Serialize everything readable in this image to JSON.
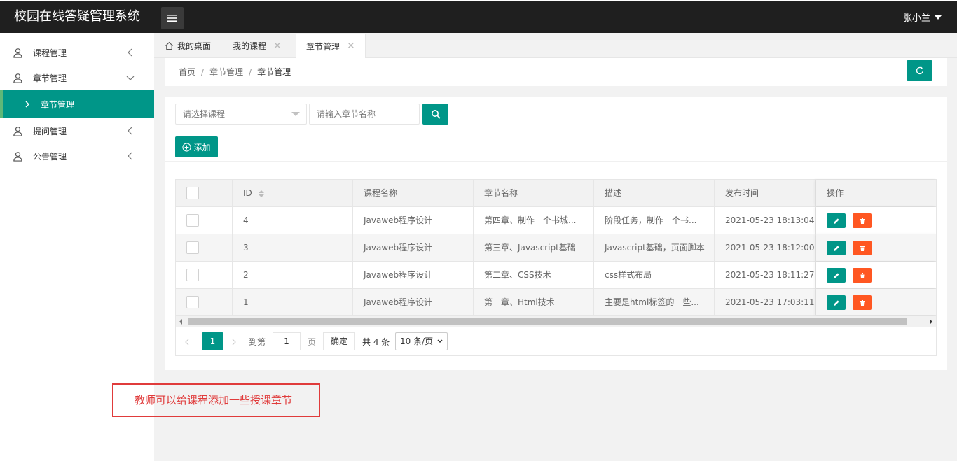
{
  "app": {
    "title": "校园在线答疑管理系统",
    "user": "张小兰"
  },
  "sidebar": {
    "items": [
      {
        "label": "课程管理"
      },
      {
        "label": "章节管理"
      },
      {
        "label": "章节管理"
      },
      {
        "label": "提问管理"
      },
      {
        "label": "公告管理"
      }
    ]
  },
  "tabs": [
    {
      "label": "我的桌面"
    },
    {
      "label": "我的课程"
    },
    {
      "label": "章节管理"
    }
  ],
  "breadcrumb": {
    "home": "首页",
    "section": "章节管理",
    "current": "章节管理",
    "separator": "/"
  },
  "filters": {
    "course_placeholder": "请选择课程",
    "name_placeholder": "请输入章节名称"
  },
  "toolbar": {
    "add_label": "添加"
  },
  "table": {
    "columns": [
      "ID",
      "课程名称",
      "章节名称",
      "描述",
      "发布时间",
      "操作"
    ],
    "rows": [
      {
        "id": "4",
        "course": "Javaweb程序设计",
        "chapter": "第四章、制作一个书城...",
        "desc": "阶段任务，制作一个书...",
        "time": "2021-05-23 18:13:04"
      },
      {
        "id": "3",
        "course": "Javaweb程序设计",
        "chapter": "第三章、Javascript基础",
        "desc": "Javascript基础，页面脚本",
        "time": "2021-05-23 18:12:00"
      },
      {
        "id": "2",
        "course": "Javaweb程序设计",
        "chapter": "第二章、CSS技术",
        "desc": "css样式布局",
        "time": "2021-05-23 18:11:27"
      },
      {
        "id": "1",
        "course": "Javaweb程序设计",
        "chapter": "第一章、Html技术",
        "desc": "主要是html标签的一些...",
        "time": "2021-05-23 17:03:11"
      }
    ]
  },
  "pagination": {
    "current_page": "1",
    "goto_label": "到第",
    "goto_value": "1",
    "page_suffix": "页",
    "confirm_label": "确定",
    "total_text": "共 4 条",
    "page_size": "10 条/页"
  },
  "annotation": {
    "text": "教师可以给课程添加一些授课章节"
  },
  "colors": {
    "primary": "#009688",
    "danger": "#ff5722",
    "header": "#1f1f1f",
    "note": "#e03b3b"
  }
}
